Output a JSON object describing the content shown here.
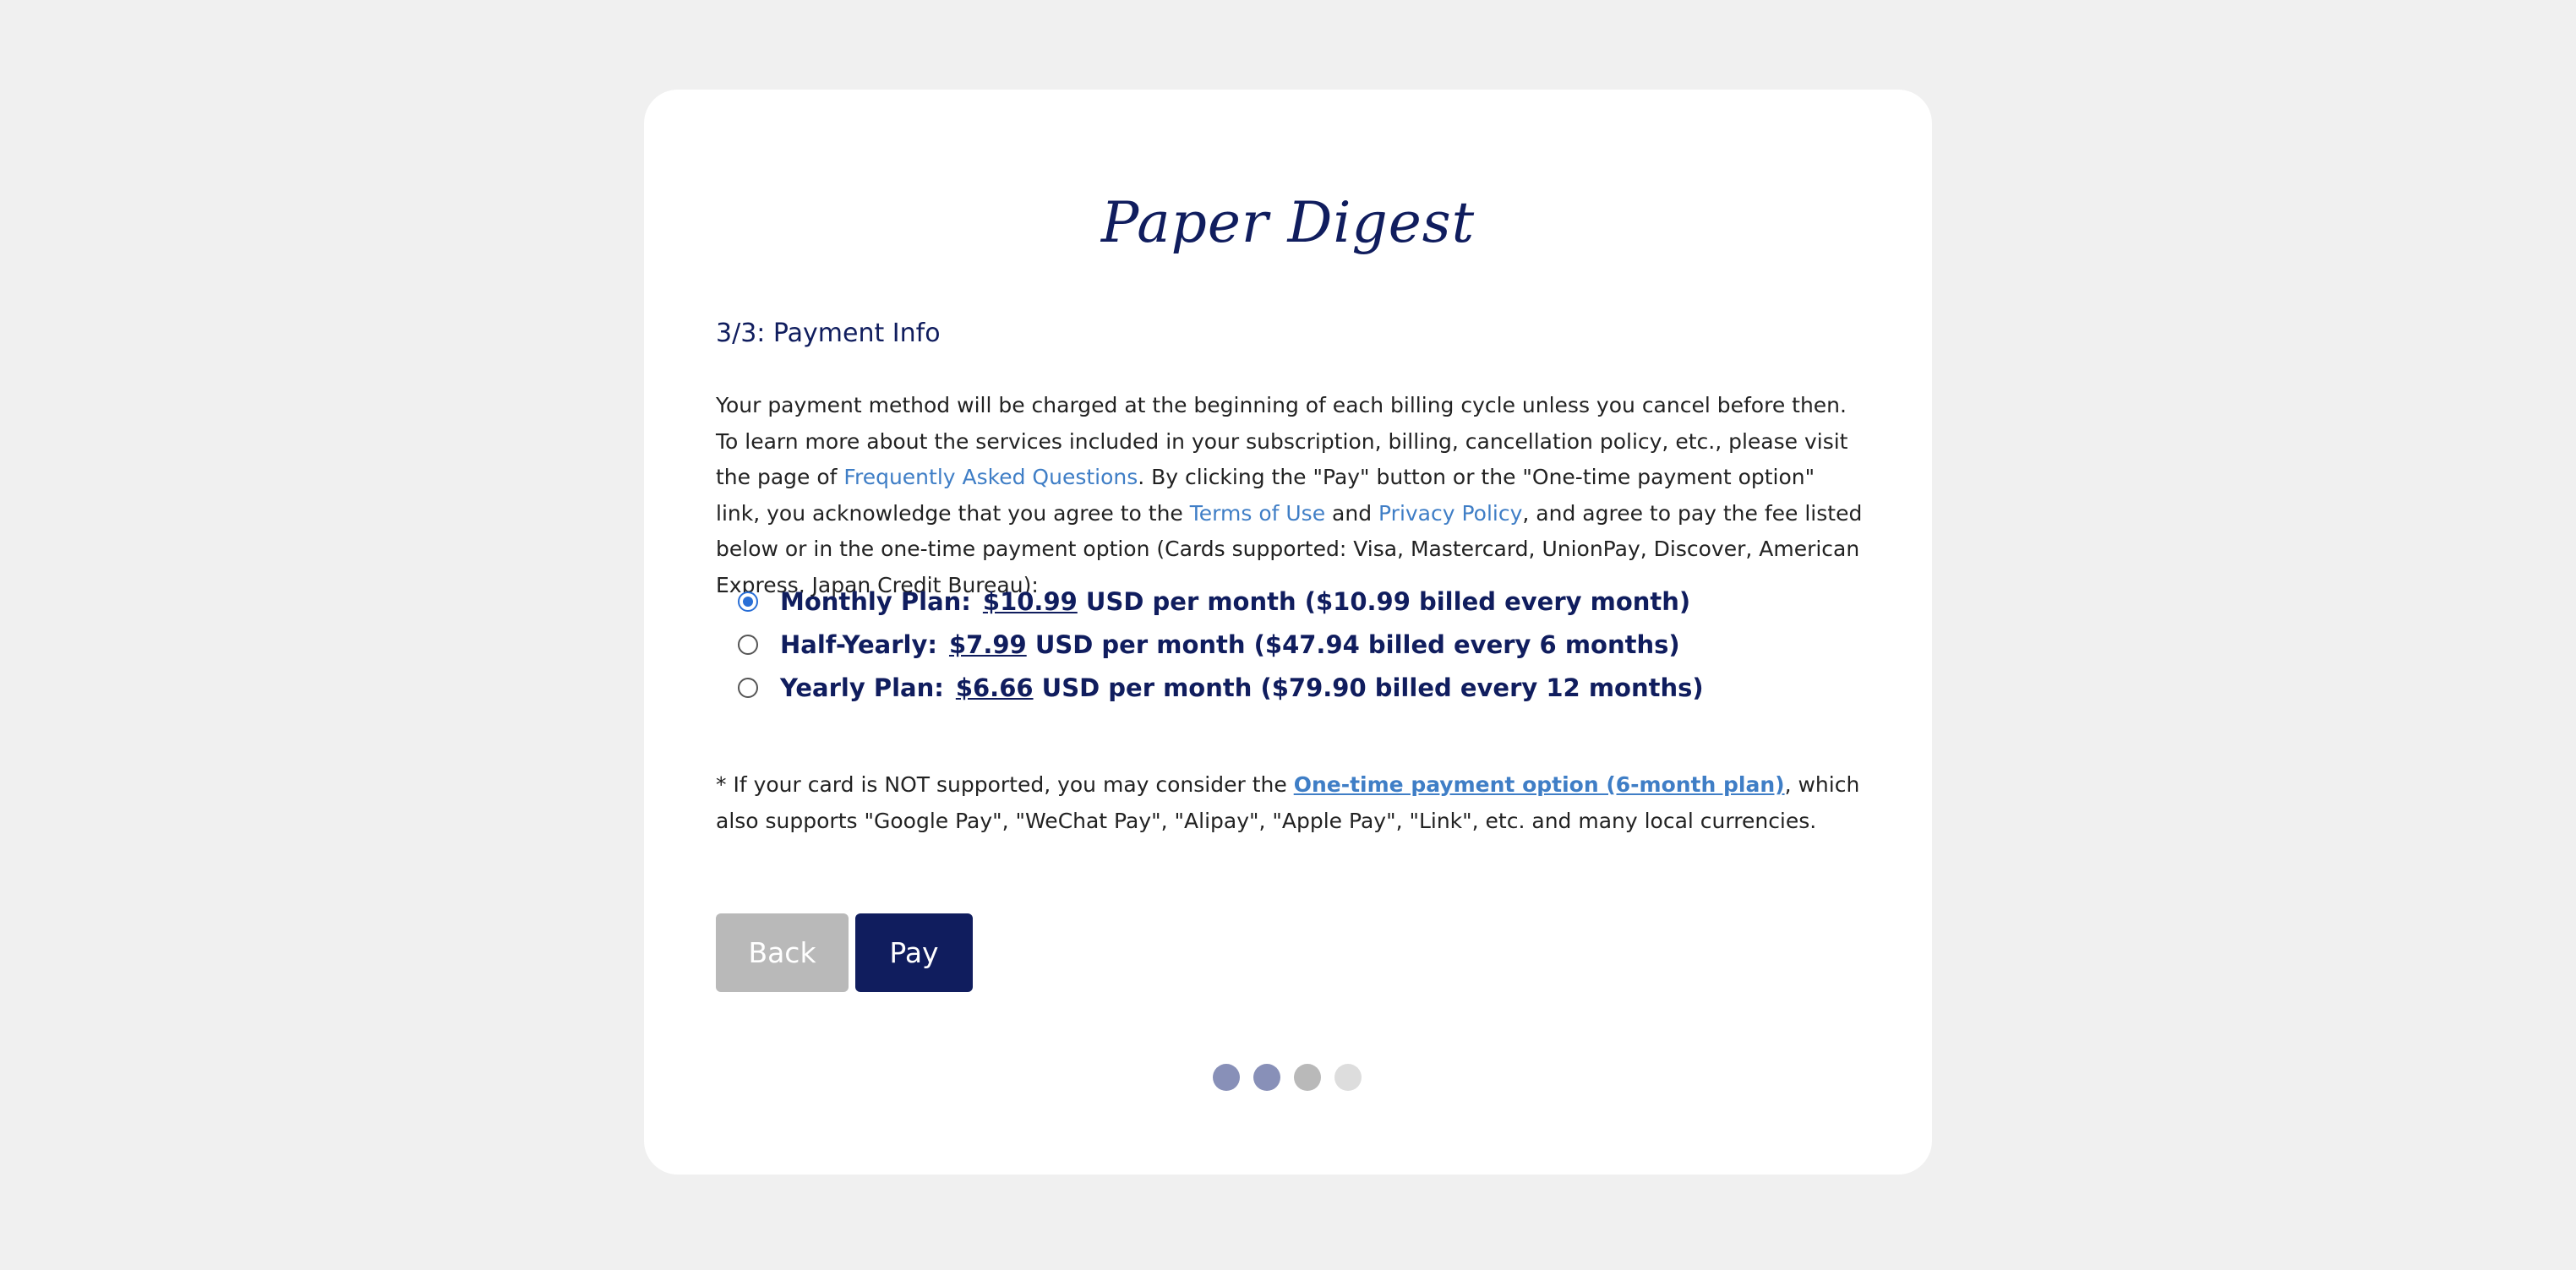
{
  "brand": {
    "logo_text": "Paper Digest"
  },
  "step": {
    "title": "3/3: Payment Info"
  },
  "intro": {
    "text_1": "Your payment method will be charged at the beginning of each billing cycle unless you cancel before then. To learn more about the services included in your subscription, billing, cancellation policy, etc., please visit the page of ",
    "faq_link": "Frequently Asked Questions",
    "text_2": ". By clicking the \"Pay\" button or the \"One-time payment option\" link, you acknowledge that you agree to the ",
    "terms_link": "Terms of Use",
    "text_3": " and ",
    "privacy_link": "Privacy Policy",
    "text_4": ", and agree to pay the fee listed below or in the one-time payment option (Cards supported: Visa, Mastercard, UnionPay, Discover, American Express, Japan Credit Bureau):"
  },
  "plans": [
    {
      "name": "Monthly Plan:",
      "price": "$10.99",
      "detail": " USD per month ($10.99 billed every month)",
      "selected": true
    },
    {
      "name": "Half-Yearly:",
      "price": "$7.99",
      "detail": " USD per month ($47.94 billed every 6 months)",
      "selected": false
    },
    {
      "name": "Yearly Plan:",
      "price": "$6.66",
      "detail": " USD per month ($79.90 billed every 12 months)",
      "selected": false
    }
  ],
  "note": {
    "text_1": "* If your card is NOT supported, you may consider the ",
    "link": "One-time payment option (6-month plan)",
    "text_2": ", which also supports \"Google Pay\", \"WeChat Pay\", \"Alipay\", \"Apple Pay\", \"Link\", etc. and many local currencies."
  },
  "buttons": {
    "back_label": "Back",
    "pay_label": "Pay"
  },
  "progress": {
    "total_steps": 4,
    "dots": [
      {
        "state": "completed",
        "color": "#8890b8"
      },
      {
        "state": "completed",
        "color": "#8890b8"
      },
      {
        "state": "current",
        "color": "#b9b9b9"
      },
      {
        "state": "upcoming",
        "color": "#dddddd"
      }
    ]
  },
  "colors": {
    "brand_navy": "#101d5e",
    "link_blue": "#3f7ec6",
    "radio_blue": "#2a6fd6",
    "back_gray": "#b9b9b9",
    "page_bg": "#f0f0f0"
  }
}
